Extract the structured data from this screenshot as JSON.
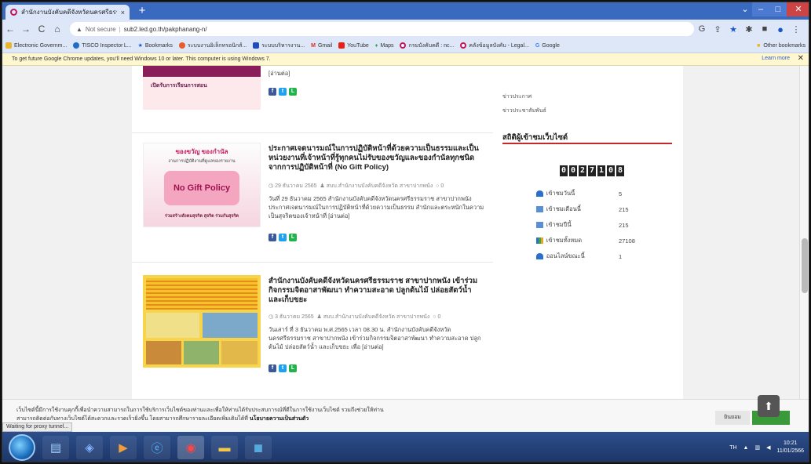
{
  "browser": {
    "tab_title": "สำนักงานบังคับคดีจังหวัดนครศรีธรรมราช",
    "tab_close": "×",
    "new_tab": "+",
    "url_warning": "Not secure",
    "url": "sub2.led.go.th/pakphanang-n/",
    "nav": {
      "back": "←",
      "forward": "→",
      "reload": "C",
      "home": "⌂"
    }
  },
  "bookmarks": {
    "items": [
      "Electronic Governm...",
      "TISCO Inspector L...",
      "Bookmarks",
      "ระบบงานอิเล็กทรอนิกส์...",
      "ระบบบริหารงาน...",
      "Gmail",
      "YouTube",
      "Maps",
      "กรมบังคับคดี : nc...",
      "คลังข้อมูลบังคับ - Legal...",
      "Google"
    ],
    "other": "Other bookmarks"
  },
  "infobar": {
    "text": "To get future Google Chrome updates, you'll need Windows 10 or later. This computer is using Windows 7.",
    "learn_more": "Learn more",
    "close": "✕"
  },
  "posts": [
    {
      "thumb_text": "เปิดรับการเรียนการสอน",
      "excerpt_tail": "[อ่านต่อ]"
    },
    {
      "thumb_top": "ของขวัญ ของกำนัล",
      "thumb_sub": "งานการปฏิบัติงานที่ดูแลของรายงาน",
      "thumb_mid": "No Gift Policy",
      "thumb_bottom": "ร่วมสร้างสังคมสุจริต สุจริต ร่วมกันสุจริต",
      "title": "ประกาศเจตนารมณ์ในการปฏิบัติหน้าที่ด้วยความเป็นธรรมและเป็นหน่วยงานที่เจ้าหน้าที่รู้ทุกคนไม่รับของขวัญและของกำนัลทุกชนิดจากการปฏิบัติหน้าที่ (No Gift Policy)",
      "date": "29 ธันวาคม 2565",
      "author": "สบบ.สำนักงานบังคับคดีจังหวัด สาขาปากพนัง",
      "comments": "0",
      "excerpt": "วันที่ 29 ธันวาคม 2565 สำนักงานบังคับคดีจังหวัดนครศรีธรรมราช สาขาปากพนัง ประกาศเจตนารมณ์ในการปฏิบัติหน้าที่ด้วยความเป็นธรรม สำนักและตระหนักในความเป็นสุจริตของเจ้าหน้าที่ [อ่านต่อ]"
    },
    {
      "title": "สำนักงานบังคับคดีจังหวัดนครศรีธรรมราช สาขาปากพนัง เข้าร่วมกิจกรรมจิตอาสาพัฒนา ทำความสะอาด ปลูกต้นไม้ ปล่อยสัตว์น้ำ และเก็บขยะ",
      "date": "3 ธันวาคม 2565",
      "author": "สบบ.สำนักงานบังคับคดีจังหวัด สาขาปากพนัง",
      "comments": "0",
      "excerpt": "วันเสาร์ ที่ 3 ธันวาคม พ.ศ.2565 เวลา 08.30 น. สำนักงานบังคับคดีจังหวัดนครศรีธรรมราช สาขาปากพนัง เข้าร่วมกิจกรรมจิตอาสาพัฒนา ทำความสะอาด ปลูกต้นไม้ ปล่อยสัตว์น้ำ และเก็บขยะ เพื่อ [อ่านต่อ]"
    }
  ],
  "sidebar": {
    "links": [
      "ข่าวประกาศ",
      "ข่าวประชาสัมพันธ์"
    ],
    "stat_title": "สถิติผู้เข้าชมเว็บไซต์",
    "counter_digits": [
      "0",
      "0",
      "2",
      "7",
      "1",
      "0",
      "8"
    ],
    "stats": [
      {
        "label": "เข้าชมวันนี้",
        "value": "5"
      },
      {
        "label": "เข้าชมเดือนนี้",
        "value": "215"
      },
      {
        "label": "เข้าชมปีนี้",
        "value": "215"
      },
      {
        "label": "เข้าชมทั้งหมด",
        "value": "27108"
      },
      {
        "label": "ออนไลน์ขณะนี้",
        "value": "1"
      }
    ]
  },
  "cookie": {
    "text_1": "เว็บไซต์นี้มีการใช้งานคุกกี้เพื่อนำความสามารถในการใช้บริการเว็บไซต์ของท่านและเพื่อให้ท่านได้รับประสบการณ์ที่ดีในการใช้งานเว็บไซต์ รวมถึงช่วยให้ท่าน",
    "text_2": "สามารถติดต่อกับทางเว็บไซต์ได้สะดวกและรวดเร็วยิ่งขึ้น โดยสามารถศึกษารายละเอียดเพิ่มเติมได้ที่",
    "policy_link": "นโยบายความเป็นส่วนตัว",
    "accept": "ยินยอม",
    "to_top": "⬆",
    "status": "Waiting for proxy tunnel..."
  },
  "taskbar": {
    "lang": "TH",
    "time": "10:21",
    "date": "11/01/2566"
  }
}
